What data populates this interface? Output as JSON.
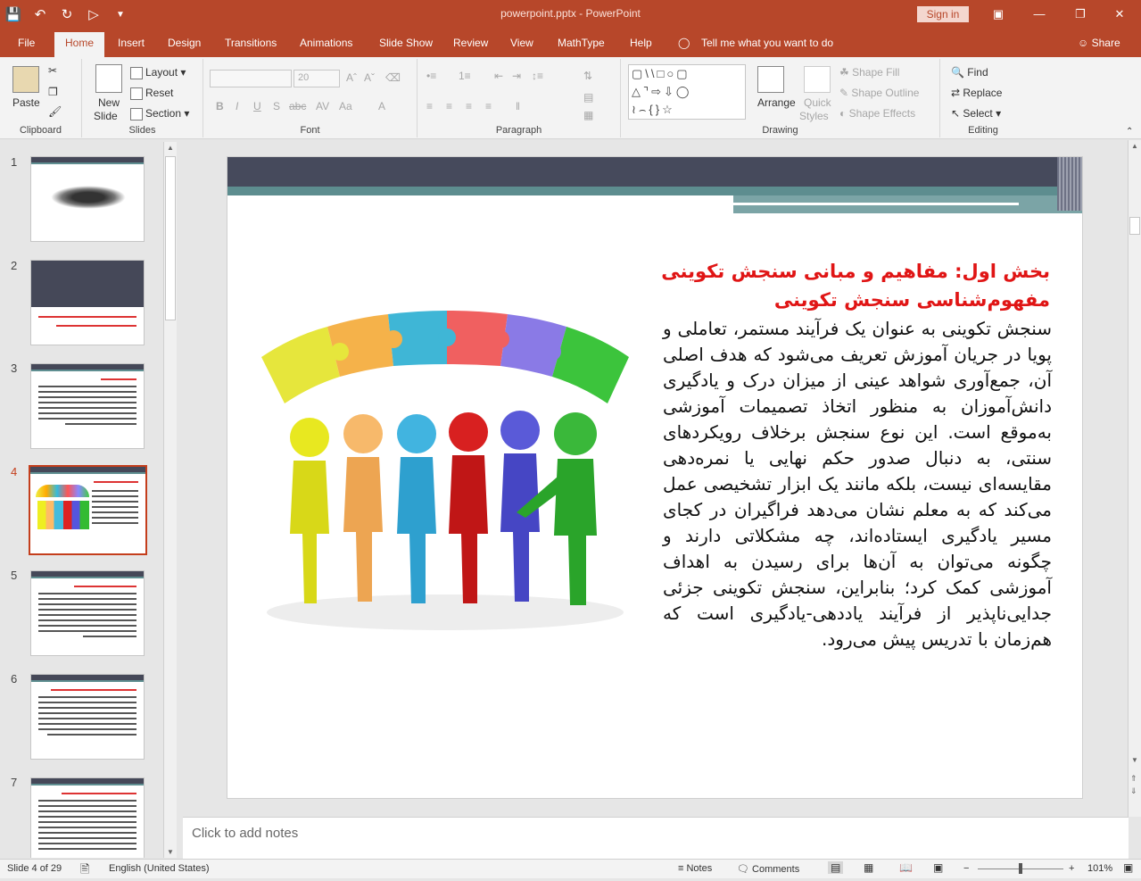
{
  "window": {
    "title": "powerpoint.pptx  -  PowerPoint",
    "sign_in": "Sign in"
  },
  "tabs": [
    "File",
    "Home",
    "Insert",
    "Design",
    "Transitions",
    "Animations",
    "Slide Show",
    "Review",
    "View",
    "MathType",
    "Help"
  ],
  "active_tab": "Home",
  "tell_me": "Tell me what you want to do",
  "share": "Share",
  "ribbon": {
    "clipboard": {
      "label": "Clipboard",
      "paste": "Paste"
    },
    "slides": {
      "label": "Slides",
      "new_slide_1": "New",
      "new_slide_2": "Slide",
      "layout": "Layout",
      "reset": "Reset",
      "section": "Section"
    },
    "font": {
      "label": "Font",
      "size": "20"
    },
    "paragraph": {
      "label": "Paragraph"
    },
    "drawing": {
      "label": "Drawing",
      "arrange": "Arrange",
      "quick_styles_1": "Quick",
      "quick_styles_2": "Styles",
      "shape_fill": "Shape Fill",
      "shape_outline": "Shape Outline",
      "shape_effects": "Shape Effects"
    },
    "editing": {
      "label": "Editing",
      "find": "Find",
      "replace": "Replace",
      "select": "Select"
    }
  },
  "thumbnails": [
    "1",
    "2",
    "3",
    "4",
    "5",
    "6",
    "7"
  ],
  "selected_slide": "4",
  "slide": {
    "title_line1": "بخش اول: مفاهیم و مبانی سنجش تکوینی",
    "title_line2": "مفهوم‌شناسی سنجش تکوینی",
    "body": "سنجش تکوینی به عنوان یک فرآیند مستمر، تعاملی و پویا در جریان آموزش تعریف می‌شود که هدف اصلی آن، جمع‌آوری شواهد عینی از میزان درک و یادگیری دانش‌آموزان به منظور اتخاذ تصمیمات آموزشی به‌موقع است. این نوع سنجش برخلاف رویکردهای سنتی، به دنبال صدور حکم نهایی یا نمره‌دهی مقایسه‌ای نیست، بلکه مانند یک ابزار تشخیصی عمل می‌کند که به معلم نشان می‌دهد فراگیران در کجای مسیر یادگیری ایستاده‌اند، چه مشکلاتی دارند و چگونه می‌توان به آن‌ها برای رسیدن به اهداف آموزشی کمک کرد؛ بنابراین، سنجش تکوینی جزئی جدایی‌ناپذیر از فرآیند یاددهی-یادگیری است که هم‌زمان با تدریس پیش می‌رود."
  },
  "notes_placeholder": "Click to add notes",
  "status": {
    "slide_of": "Slide 4 of 29",
    "language": "English (United States)",
    "notes": "Notes",
    "comments": "Comments",
    "zoom": "101%"
  },
  "colors": {
    "accent": "#b7472a",
    "slide_header": "#464a5c",
    "teal": "#5d8d8f",
    "title_red": "#e01515"
  }
}
